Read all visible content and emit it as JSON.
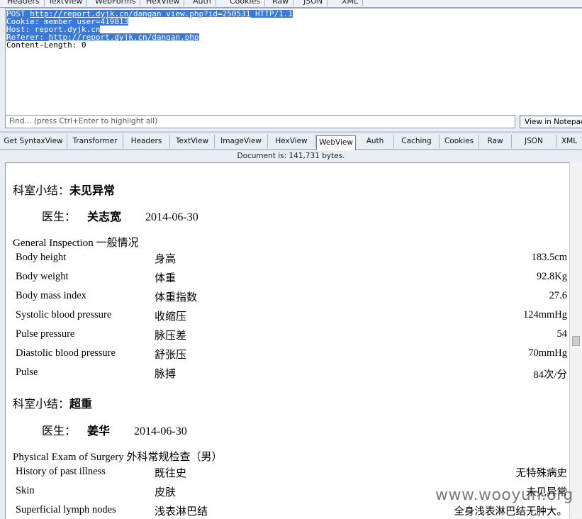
{
  "request_raw": {
    "method": "POST",
    "url": "http://report.dyjk.cn/dangan_view.php?id=250531",
    "protocol": "HTTP/1.1",
    "cookie": "Cookie: member_user=419813",
    "host": "Host: report.dyjk.cn",
    "referer_label": "Referer: ",
    "referer_url": "http://report.dyjk.cn/dangan.php",
    "content_length": "Content-Length: 0"
  },
  "find_bar": {
    "placeholder": "Find... (press Ctrl+Enter to highlight all)",
    "notepad_label": "View in Notepad"
  },
  "response_tabs": [
    "Get SyntaxView",
    "Transformer",
    "Headers",
    "TextView",
    "ImageView",
    "HexView",
    "WebView",
    "Auth",
    "Caching",
    "Cookies",
    "Raw",
    "JSON",
    "XML"
  ],
  "active_tab": "WebView",
  "document_info": "Document is: 141,731 bytes.",
  "report": {
    "section1": {
      "summary_label": "科室小结：",
      "summary_value": "未见异常",
      "doctor_label": "医生：",
      "doctor_name": "关志宽",
      "date": "2014-06-30"
    },
    "general_title": "General Inspection 一般情况",
    "general_rows": [
      {
        "en": "Body height",
        "cn": "身高",
        "value": "183.5cm"
      },
      {
        "en": "Body weight",
        "cn": "体重",
        "value": "92.8Kg"
      },
      {
        "en": "Body mass index",
        "cn": "体重指数",
        "value": "27.6"
      },
      {
        "en": "Systolic blood pressure",
        "cn": "收缩压",
        "value": "124mmHg"
      },
      {
        "en": "Pulse pressure",
        "cn": "脉压差",
        "value": "54"
      },
      {
        "en": "Diastolic blood pressure",
        "cn": "舒张压",
        "value": "70mmHg"
      },
      {
        "en": "Pulse",
        "cn": "脉搏",
        "value": "84次/分"
      }
    ],
    "section2": {
      "summary_label": "科室小结：",
      "summary_value": "超重",
      "doctor_label": "医生：",
      "doctor_name": "姜华",
      "date": "2014-06-30"
    },
    "surgery_title": "Physical Exam of Surgery 外科常规检查（男）",
    "surgery_rows": [
      {
        "en": "History of past illness",
        "cn": "既往史",
        "value": "无特殊病史"
      },
      {
        "en": "Skin",
        "cn": "皮肤",
        "value": "未见异常"
      },
      {
        "en": "Superficial lymph nodes",
        "cn": "浅表淋巴结",
        "value": "全身浅表淋巴结无肿大。"
      }
    ]
  },
  "watermark": "www.wooyun.org"
}
